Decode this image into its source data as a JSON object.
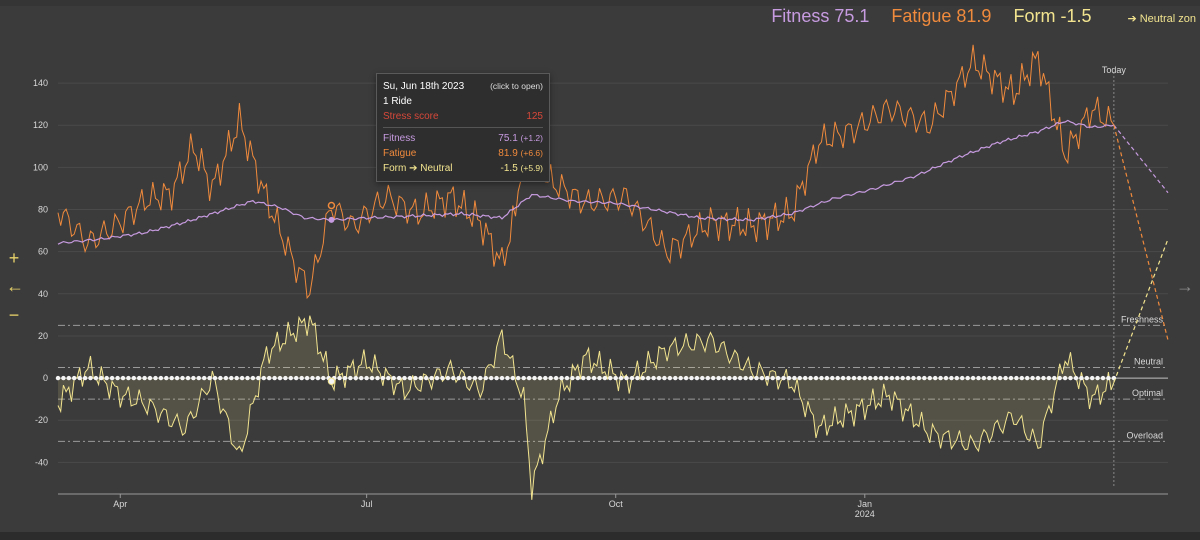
{
  "header": {
    "fitness_label": "Fitness 75.1",
    "fatigue_label": "Fatigue 81.9",
    "form_label": "Form -1.5",
    "neutral_zone_label": "➔ Neutral zon"
  },
  "tooltip": {
    "date": "Su, Jun 18th 2023",
    "hint": "(click to open)",
    "rides": "1 Ride",
    "stress_label": "Stress score",
    "stress_value": "125",
    "fitness_label": "Fitness",
    "fitness_value": "75.1",
    "fitness_delta": "(+1.2)",
    "fatigue_label": "Fatigue",
    "fatigue_value": "81.9",
    "fatigue_delta": "(+6.6)",
    "form_label": "Form ➔ Neutral",
    "form_value": "-1.5",
    "form_delta": "(+5.9)"
  },
  "controls": {
    "zoom_in": "+",
    "back": "←",
    "zoom_out": "−",
    "forward": "→"
  },
  "colors": {
    "fitness": "#c79be0",
    "fatigue": "#f08a3c",
    "form": "#f2e48f",
    "stress": "#d7483a",
    "grid": "#4a4a4a",
    "zone_line": "#9a9a9a"
  },
  "chart_data": {
    "type": "line",
    "y_ticks": [
      140,
      120,
      100,
      80,
      60,
      40,
      20,
      0,
      -20,
      -40
    ],
    "ylim": [
      -55,
      150
    ],
    "x_ticks": [
      {
        "label": "Apr",
        "sublabel": "",
        "date": "2023-04-01"
      },
      {
        "label": "Jul",
        "sublabel": "",
        "date": "2023-07-01"
      },
      {
        "label": "Oct",
        "sublabel": "",
        "date": "2023-10-01"
      },
      {
        "label": "Jan",
        "sublabel": "2024",
        "date": "2024-01-01"
      }
    ],
    "xlim": [
      "2023-03-09",
      "2024-04-22"
    ],
    "today": {
      "label": "Today",
      "date": "2024-04-02"
    },
    "hover": {
      "date": "2023-06-18",
      "fitness": 75.1,
      "fatigue": 81.9,
      "form": -1.5
    },
    "zones": [
      {
        "label": "Freshness",
        "value": 25
      },
      {
        "label": "Neutral",
        "value": 5
      },
      {
        "label": "Optimal",
        "value": -10
      },
      {
        "label": "Overload",
        "value": -30
      }
    ],
    "series": [
      {
        "name": "Fitness",
        "points": [
          [
            "2023-03-09",
            64
          ],
          [
            "2023-03-25",
            66
          ],
          [
            "2023-04-10",
            69
          ],
          [
            "2023-04-25",
            74
          ],
          [
            "2023-05-10",
            80
          ],
          [
            "2023-05-20",
            84
          ],
          [
            "2023-05-30",
            81
          ],
          [
            "2023-06-08",
            76
          ],
          [
            "2023-06-18",
            75.1
          ],
          [
            "2023-07-01",
            76
          ],
          [
            "2023-07-20",
            77
          ],
          [
            "2023-08-05",
            78
          ],
          [
            "2023-08-20",
            76
          ],
          [
            "2023-08-31",
            87
          ],
          [
            "2023-09-15",
            84
          ],
          [
            "2023-10-01",
            83
          ],
          [
            "2023-10-15",
            80
          ],
          [
            "2023-11-01",
            76
          ],
          [
            "2023-11-20",
            75
          ],
          [
            "2023-12-05",
            78
          ],
          [
            "2023-12-20",
            85
          ],
          [
            "2024-01-05",
            90
          ],
          [
            "2024-01-20",
            96
          ],
          [
            "2024-02-05",
            105
          ],
          [
            "2024-02-20",
            112
          ],
          [
            "2024-03-05",
            117
          ],
          [
            "2024-03-15",
            122
          ],
          [
            "2024-03-25",
            119
          ],
          [
            "2024-04-02",
            120
          ]
        ]
      },
      {
        "name": "Fatigue",
        "points": [
          [
            "2023-03-09",
            80
          ],
          [
            "2023-03-20",
            64
          ],
          [
            "2023-03-30",
            72
          ],
          [
            "2023-04-10",
            84
          ],
          [
            "2023-04-20",
            88
          ],
          [
            "2023-04-28",
            110
          ],
          [
            "2023-05-05",
            90
          ],
          [
            "2023-05-15",
            122
          ],
          [
            "2023-05-25",
            85
          ],
          [
            "2023-06-04",
            55
          ],
          [
            "2023-06-10",
            42
          ],
          [
            "2023-06-18",
            81.9
          ],
          [
            "2023-06-26",
            72
          ],
          [
            "2023-07-08",
            86
          ],
          [
            "2023-07-20",
            78
          ],
          [
            "2023-08-01",
            86
          ],
          [
            "2023-08-12",
            74
          ],
          [
            "2023-08-20",
            54
          ],
          [
            "2023-08-25",
            78
          ],
          [
            "2023-08-31",
            148
          ],
          [
            "2023-09-05",
            95
          ],
          [
            "2023-09-20",
            83
          ],
          [
            "2023-10-05",
            86
          ],
          [
            "2023-10-20",
            60
          ],
          [
            "2023-11-05",
            74
          ],
          [
            "2023-11-20",
            72
          ],
          [
            "2023-12-05",
            78
          ],
          [
            "2023-12-15",
            112
          ],
          [
            "2023-12-28",
            118
          ],
          [
            "2024-01-10",
            128
          ],
          [
            "2024-01-25",
            120
          ],
          [
            "2024-02-10",
            150
          ],
          [
            "2024-02-25",
            135
          ],
          [
            "2024-03-05",
            152
          ],
          [
            "2024-03-15",
            106
          ],
          [
            "2024-03-25",
            128
          ],
          [
            "2024-04-02",
            120
          ]
        ]
      },
      {
        "name": "Form",
        "points": [
          [
            "2023-03-09",
            -12
          ],
          [
            "2023-03-20",
            5
          ],
          [
            "2023-04-01",
            -8
          ],
          [
            "2023-04-10",
            -12
          ],
          [
            "2023-04-25",
            -24
          ],
          [
            "2023-05-05",
            0
          ],
          [
            "2023-05-15",
            -38
          ],
          [
            "2023-05-25",
            12
          ],
          [
            "2023-06-04",
            22
          ],
          [
            "2023-06-10",
            28
          ],
          [
            "2023-06-18",
            -1.5
          ],
          [
            "2023-07-01",
            8
          ],
          [
            "2023-07-15",
            -6
          ],
          [
            "2023-08-01",
            4
          ],
          [
            "2023-08-12",
            -6
          ],
          [
            "2023-08-20",
            20
          ],
          [
            "2023-08-28",
            -10
          ],
          [
            "2023-08-31",
            -52
          ],
          [
            "2023-09-10",
            -8
          ],
          [
            "2023-09-20",
            10
          ],
          [
            "2023-10-05",
            -2
          ],
          [
            "2023-10-20",
            14
          ],
          [
            "2023-11-05",
            18
          ],
          [
            "2023-11-20",
            4
          ],
          [
            "2023-12-05",
            -2
          ],
          [
            "2023-12-15",
            -24
          ],
          [
            "2023-12-28",
            -16
          ],
          [
            "2024-01-10",
            -8
          ],
          [
            "2024-01-25",
            -26
          ],
          [
            "2024-02-10",
            -32
          ],
          [
            "2024-02-25",
            -18
          ],
          [
            "2024-03-05",
            -32
          ],
          [
            "2024-03-15",
            10
          ],
          [
            "2024-03-25",
            -10
          ],
          [
            "2024-04-02",
            -2
          ]
        ]
      }
    ],
    "projections": [
      {
        "name": "Fitness",
        "points": [
          [
            "2024-04-02",
            120
          ],
          [
            "2024-04-22",
            88
          ]
        ]
      },
      {
        "name": "Fatigue",
        "points": [
          [
            "2024-04-02",
            120
          ],
          [
            "2024-04-22",
            18
          ]
        ]
      },
      {
        "name": "Form",
        "points": [
          [
            "2024-04-02",
            -2
          ],
          [
            "2024-04-22",
            66
          ]
        ]
      }
    ]
  }
}
